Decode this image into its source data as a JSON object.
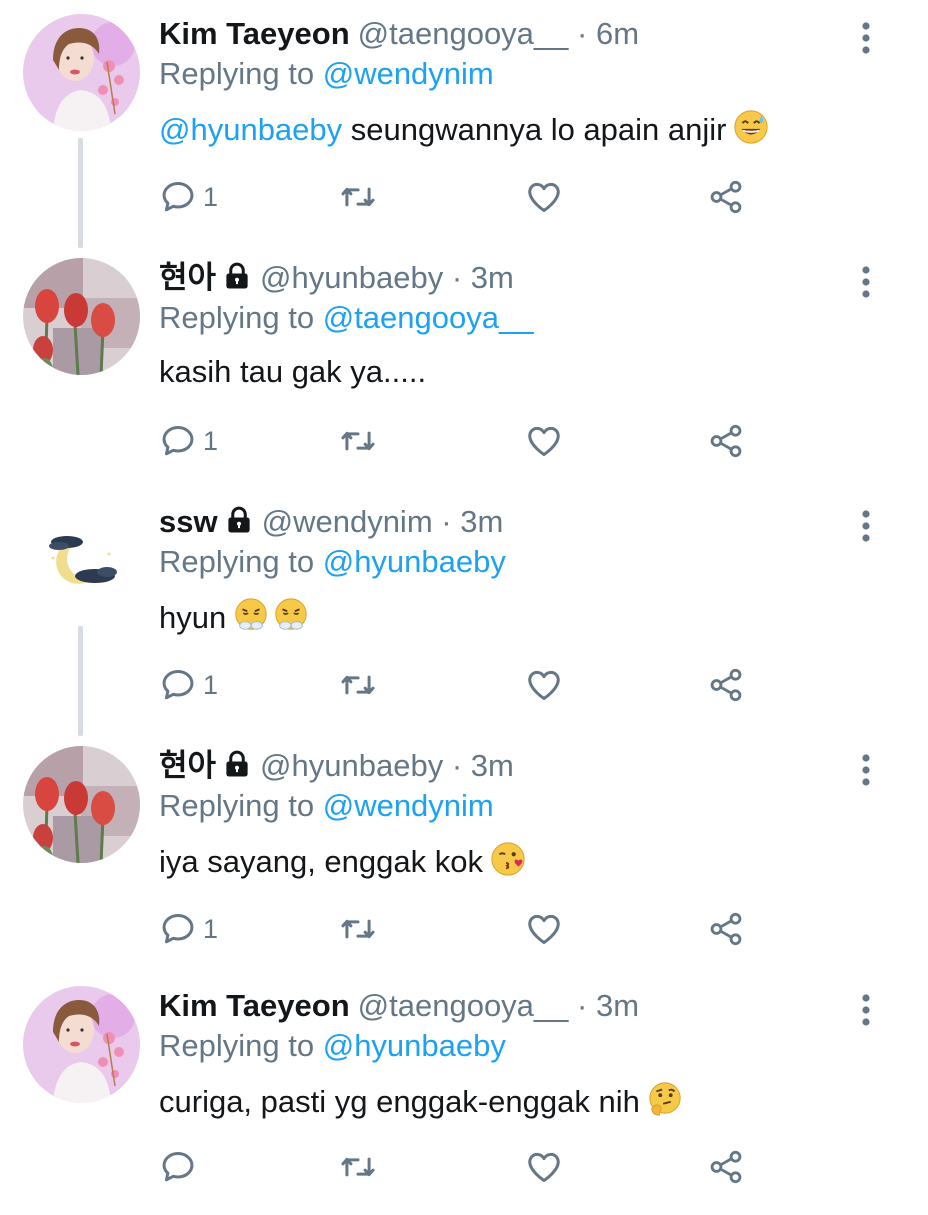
{
  "tweets": [
    {
      "display_name": "Kim Taeyeon",
      "locked": false,
      "handle": "@taengooya__",
      "separator": "·",
      "time": "6m",
      "replying_prefix": "Replying to",
      "replying_to": "@wendynim",
      "mention": "@hyunbaeby",
      "text": " seungwannya lo apain anjir",
      "emoji": "grinning-sweat",
      "reply_count": "1",
      "avatar": "person-pink"
    },
    {
      "display_name": "현아",
      "locked": true,
      "handle": "@hyunbaeby",
      "separator": "·",
      "time": "3m",
      "replying_prefix": "Replying to",
      "replying_to": "@taengooya__",
      "mention": "",
      "text": "kasih tau gak ya.....",
      "emoji": "",
      "reply_count": "1",
      "avatar": "tulips"
    },
    {
      "display_name": "ssw",
      "locked": true,
      "handle": "@wendynim",
      "separator": "·",
      "time": "3m",
      "replying_prefix": "Replying to",
      "replying_to": "@hyunbaeby",
      "mention": "",
      "text": "hyun",
      "emoji": "steam-nose-x2",
      "reply_count": "1",
      "avatar": "moon-cloud"
    },
    {
      "display_name": "현아",
      "locked": true,
      "handle": "@hyunbaeby",
      "separator": "·",
      "time": "3m",
      "replying_prefix": "Replying to",
      "replying_to": "@wendynim",
      "mention": "",
      "text": "iya sayang, enggak kok",
      "emoji": "kiss-wink",
      "reply_count": "1",
      "avatar": "tulips"
    },
    {
      "display_name": "Kim Taeyeon",
      "locked": false,
      "handle": "@taengooya__",
      "separator": "·",
      "time": "3m",
      "replying_prefix": "Replying to",
      "replying_to": "@hyunbaeby",
      "mention": "",
      "text": "curiga, pasti yg enggak-enggak nih",
      "emoji": "thinking",
      "reply_count": "",
      "avatar": "person-pink"
    }
  ],
  "icons": {
    "reply": "reply-icon",
    "retweet": "retweet-icon",
    "like": "heart-icon",
    "share": "share-icon",
    "more": "more-vertical-icon",
    "lock": "lock-icon"
  },
  "colors": {
    "link": "#1da1f2",
    "secondary_text": "#657786",
    "primary_text": "#14171a",
    "thread_line": "#d6dce1"
  }
}
